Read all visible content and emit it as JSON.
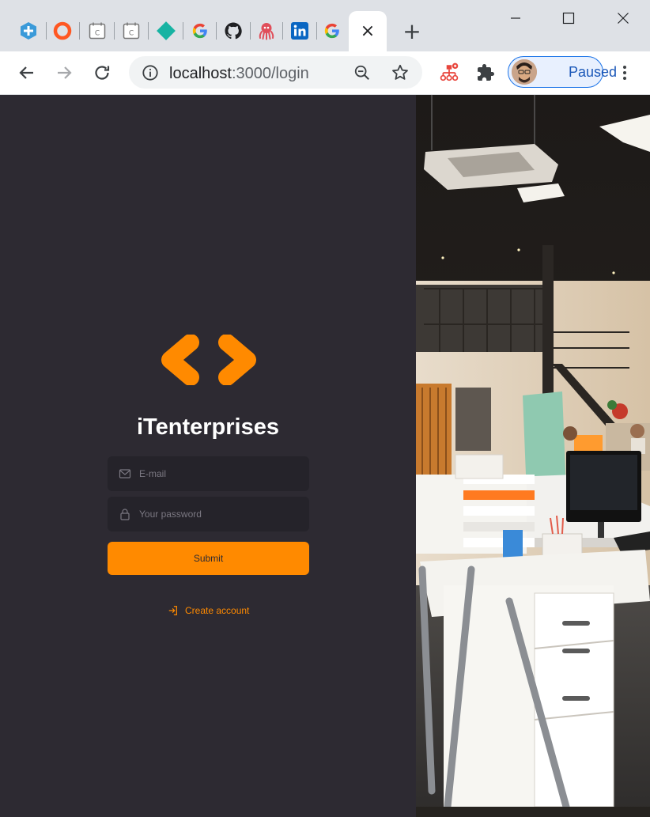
{
  "browser": {
    "active_tab_close_label": "×",
    "new_tab_label": "+",
    "tabs": [
      {
        "icon": "plus-hexagon-icon",
        "color": "#3a9ad9"
      },
      {
        "icon": "orange-ring-icon",
        "color": "#ff5722"
      },
      {
        "icon": "calendar-c-icon",
        "letter": "C"
      },
      {
        "icon": "calendar-c-icon",
        "letter": "C"
      },
      {
        "icon": "teal-diamond-icon",
        "color": "#17b3a3"
      },
      {
        "icon": "google-icon"
      },
      {
        "icon": "github-icon"
      },
      {
        "icon": "octopus-icon",
        "color": "#e04e5a"
      },
      {
        "icon": "linkedin-icon",
        "color": "#0a66c2"
      },
      {
        "icon": "google-icon"
      }
    ],
    "address": {
      "host": "localhost",
      "rest": ":3000/login"
    },
    "profile_label": "Paused"
  },
  "login": {
    "brand": "iTenterprises",
    "email_placeholder": "E-mail",
    "password_placeholder": "Your password",
    "submit_label": "Submit",
    "create_account_label": "Create account",
    "accent_color": "#ff8a00",
    "panel_color": "#2d2a32"
  }
}
